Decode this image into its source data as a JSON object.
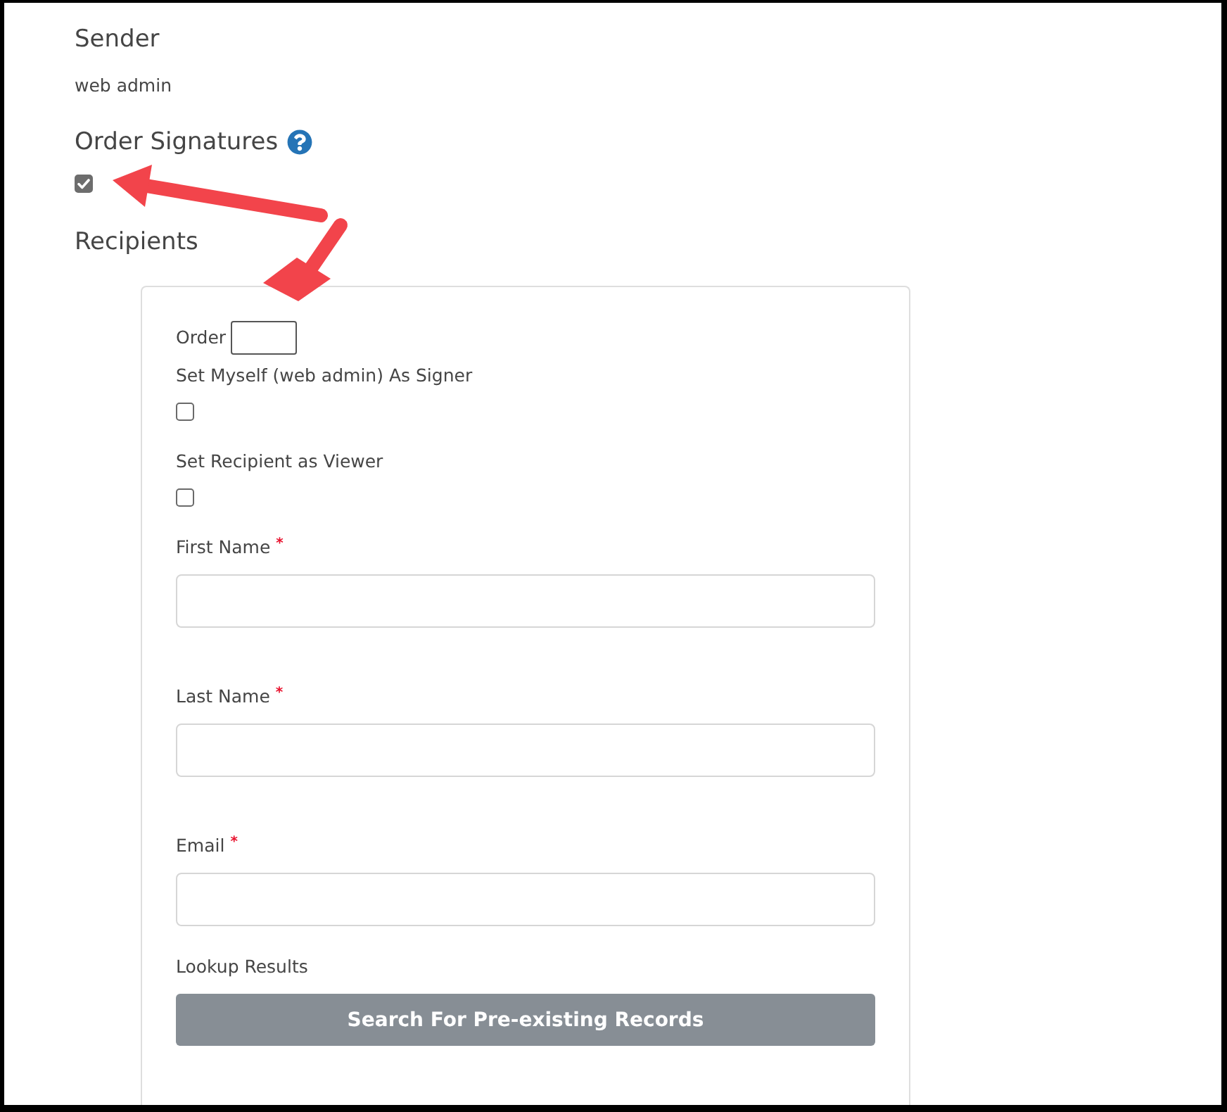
{
  "sender": {
    "heading": "Sender",
    "name": "web admin"
  },
  "order_signatures": {
    "heading": "Order Signatures",
    "checked": true
  },
  "recipients": {
    "heading": "Recipients",
    "order_label": "Order",
    "options": [
      {
        "label": "Set Myself (web admin) As Signer",
        "checked": false
      },
      {
        "label": "Set Recipient as Viewer",
        "checked": false
      }
    ],
    "fields": [
      {
        "label": "First Name",
        "required_mark": "*"
      },
      {
        "label": "Last Name",
        "required_mark": "*"
      },
      {
        "label": "Email",
        "required_mark": "*"
      }
    ],
    "lookup_label": "Lookup Results",
    "search_button": "Search For Pre-existing Records"
  }
}
